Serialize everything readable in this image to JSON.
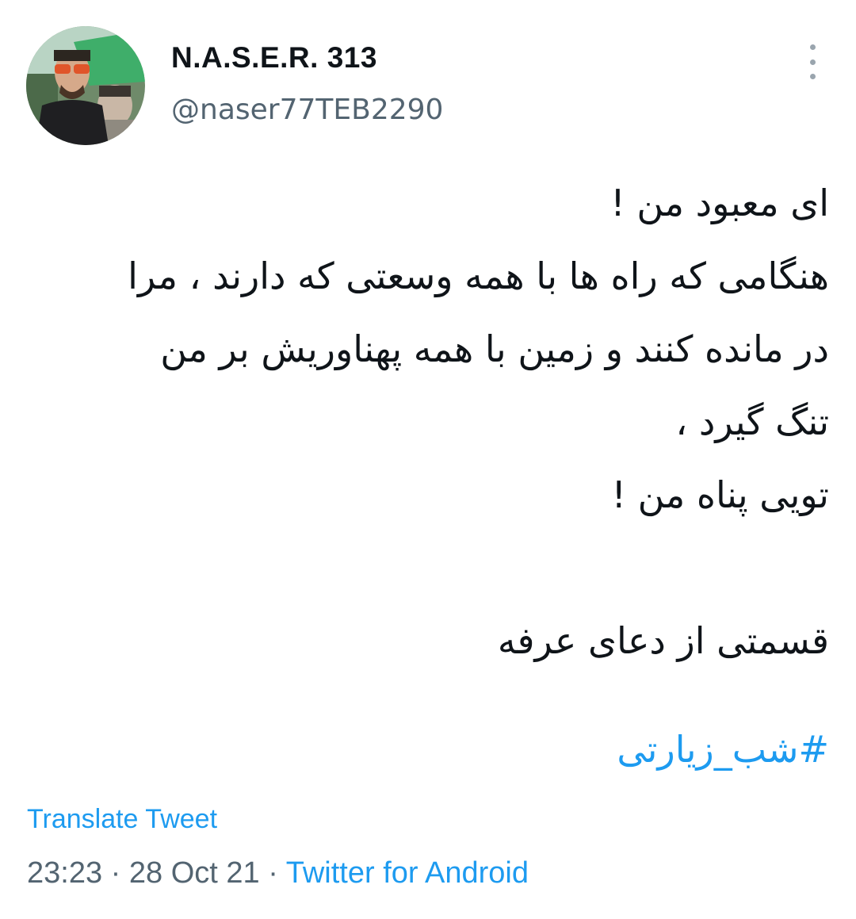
{
  "author": {
    "display_name": "N.A.S.E.R. 313",
    "handle": "@naser77TEB2290"
  },
  "tweet": {
    "lines": [
      "ای معبود من !",
      "هنگامی که راه ها با همه وسعتی که دارند ، مرا",
      "در مانده کنند و زمین با همه پهناوریش بر من",
      "تنگ گیرد ،",
      "تویی پناه من !",
      "",
      "قسمتی از دعای عرفه"
    ],
    "hashtag": "#شب_زیارتی"
  },
  "translate_label": "Translate Tweet",
  "meta": {
    "time": "23:23",
    "separator": "·",
    "date": "28 Oct 21",
    "source": "Twitter for Android"
  },
  "colors": {
    "link_blue": "#1d9bf0",
    "text_primary": "#0f1419",
    "text_secondary": "#536471"
  },
  "icons": {
    "more": "more-vertical-icon"
  }
}
